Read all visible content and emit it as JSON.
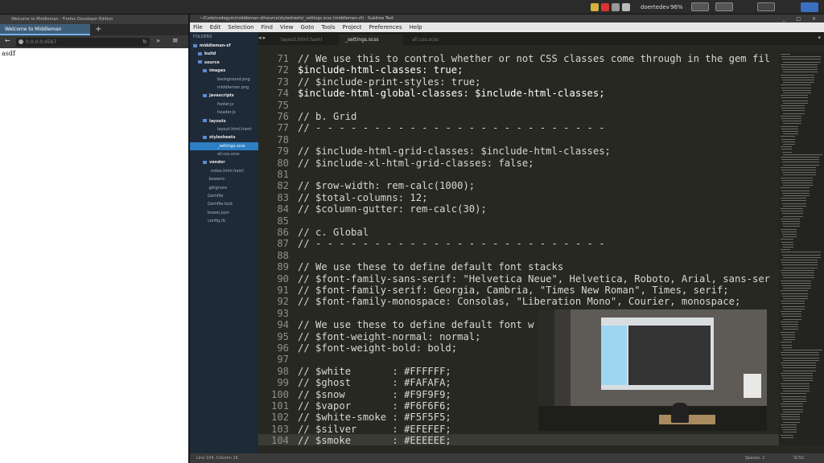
{
  "system_tray": {
    "user": "doertedev",
    "battery": "96%",
    "colors": {
      "bar": "#2b2b2b"
    }
  },
  "firefox": {
    "window_title": "Welcome to Middleman - Firefox Developer Edition",
    "tab_title": "Welcome to Middleman",
    "url": "0.0.0.0:4567",
    "page_text": "asdf"
  },
  "sublime": {
    "window_title": "~/Code/codegym/middleman-zf/source/stylesheets/_settings.scss (middleman-zf) - Sublime Text",
    "menu": [
      "File",
      "Edit",
      "Selection",
      "Find",
      "View",
      "Goto",
      "Tools",
      "Project",
      "Preferences",
      "Help"
    ],
    "folders_header": "FOLDERS",
    "tree": [
      {
        "label": "middleman-zf",
        "type": "folder"
      },
      {
        "label": "build",
        "type": "folder"
      },
      {
        "label": "source",
        "type": "folder"
      },
      {
        "label": "images",
        "type": "folder"
      },
      {
        "label": "background.png",
        "type": "file"
      },
      {
        "label": "middleman.png",
        "type": "file"
      },
      {
        "label": "javascripts",
        "type": "folder"
      },
      {
        "label": "footer.js",
        "type": "file"
      },
      {
        "label": "header.js",
        "type": "file"
      },
      {
        "label": "layouts",
        "type": "folder"
      },
      {
        "label": "layout.html.haml",
        "type": "file"
      },
      {
        "label": "stylesheets",
        "type": "folder"
      },
      {
        "label": "_settings.scss",
        "type": "file",
        "selected": true
      },
      {
        "label": "all.css.scss",
        "type": "file"
      },
      {
        "label": "vendor",
        "type": "folder"
      },
      {
        "label": "index.html.haml",
        "type": "file"
      },
      {
        "label": ".bowerrc",
        "type": "file"
      },
      {
        "label": ".gitignore",
        "type": "file"
      },
      {
        "label": "Gemfile",
        "type": "file"
      },
      {
        "label": "Gemfile.lock",
        "type": "file"
      },
      {
        "label": "bower.json",
        "type": "file"
      },
      {
        "label": "config.rb",
        "type": "file"
      }
    ],
    "tabs": [
      "layout.html.haml",
      "_settings.scss",
      "all.css.scss"
    ],
    "active_tab": "_settings.scss",
    "lines": [
      {
        "n": "71",
        "t": "// We use this to control whether or not CSS classes come through in the gem fil"
      },
      {
        "n": "72",
        "t": "$include-html-classes: true;",
        "var": true
      },
      {
        "n": "73",
        "t": "// $include-print-styles: true;"
      },
      {
        "n": "74",
        "t": "$include-html-global-classes: $include-html-classes;",
        "var": true
      },
      {
        "n": "75",
        "t": ""
      },
      {
        "n": "76",
        "t": "// b. Grid"
      },
      {
        "n": "77",
        "t": "// - - - - - - - - - - - - - - - - - - - - - - - - -"
      },
      {
        "n": "78",
        "t": ""
      },
      {
        "n": "79",
        "t": "// $include-html-grid-classes: $include-html-classes;"
      },
      {
        "n": "80",
        "t": "// $include-xl-html-grid-classes: false;"
      },
      {
        "n": "81",
        "t": ""
      },
      {
        "n": "82",
        "t": "// $row-width: rem-calc(1000);"
      },
      {
        "n": "83",
        "t": "// $total-columns: 12;"
      },
      {
        "n": "84",
        "t": "// $column-gutter: rem-calc(30);"
      },
      {
        "n": "85",
        "t": ""
      },
      {
        "n": "86",
        "t": "// c. Global"
      },
      {
        "n": "87",
        "t": "// - - - - - - - - - - - - - - - - - - - - - - - - -"
      },
      {
        "n": "88",
        "t": ""
      },
      {
        "n": "89",
        "t": "// We use these to define default font stacks"
      },
      {
        "n": "90",
        "t": "// $font-family-sans-serif: \"Helvetica Neue\", Helvetica, Roboto, Arial, sans-ser"
      },
      {
        "n": "91",
        "t": "// $font-family-serif: Georgia, Cambria, \"Times New Roman\", Times, serif;"
      },
      {
        "n": "92",
        "t": "// $font-family-monospace: Consolas, \"Liberation Mono\", Courier, monospace;"
      },
      {
        "n": "93",
        "t": ""
      },
      {
        "n": "94",
        "t": "// We use these to define default font w"
      },
      {
        "n": "95",
        "t": "// $font-weight-normal: normal;"
      },
      {
        "n": "96",
        "t": "// $font-weight-bold: bold;"
      },
      {
        "n": "97",
        "t": ""
      },
      {
        "n": "98",
        "t": "// $white       : #FFFFFF;"
      },
      {
        "n": "99",
        "t": "// $ghost       : #FAFAFA;"
      },
      {
        "n": "100",
        "t": "// $snow        : #F9F9F9;"
      },
      {
        "n": "101",
        "t": "// $vapor       : #F6F6F6;"
      },
      {
        "n": "102",
        "t": "// $white-smoke : #F5F5F5;"
      },
      {
        "n": "103",
        "t": "// $silver      : #EFEFEF;"
      },
      {
        "n": "104",
        "t": "// $smoke       : #EEEEEE;",
        "current": true
      }
    ],
    "status_left": "Line 104, Column 16",
    "status_spaces": "Spaces: 2",
    "status_syntax": "SCSS",
    "colors": {
      "background": "#272822",
      "sidebar": "#1f2a38",
      "selection": "#2d7ec2"
    }
  }
}
